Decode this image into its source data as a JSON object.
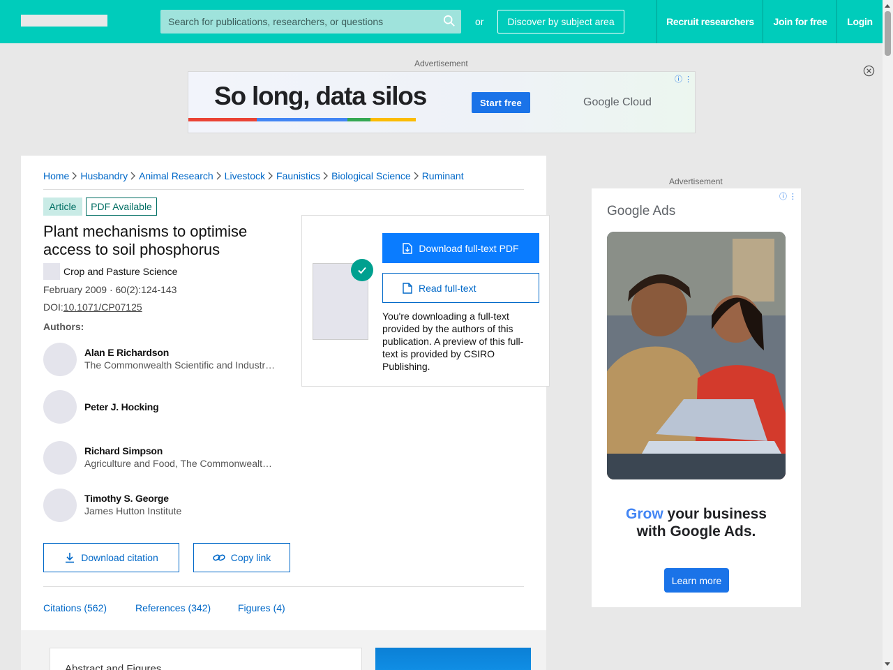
{
  "header": {
    "search_placeholder": "Search for publications, researchers, or questions",
    "or_text": "or",
    "discover_label": "Discover by subject area",
    "recruit_label": "Recruit researchers",
    "join_label": "Join for free",
    "login_label": "Login"
  },
  "ads": {
    "label": "Advertisement",
    "banner": {
      "headline": "So long, data silos",
      "cta": "Start free",
      "brand": "Google Cloud"
    },
    "side": {
      "brand": "Google Ads",
      "tagline_accent": "Grow",
      "tagline_line1_rest": " your business",
      "tagline_line2": "with Google Ads.",
      "cta": "Learn more"
    }
  },
  "breadcrumb": [
    "Home",
    "Husbandry",
    "Animal Research",
    "Livestock",
    "Faunistics",
    "Biological Science",
    "Ruminant"
  ],
  "publication": {
    "type_badge": "Article",
    "pdf_badge": "PDF Available",
    "title": "Plant mechanisms to optimise access to soil phosphorus",
    "journal": "Crop and Pasture Science",
    "date_pages": "February 2009 · 60(2):124-143",
    "doi_label": "DOI:",
    "doi": "10.1071/CP07125",
    "authors_label": "Authors:",
    "authors": [
      {
        "name": "Alan E Richardson",
        "affiliation": "The Commonwealth Scientific and Industrial Research Organisation"
      },
      {
        "name": "Peter J. Hocking",
        "affiliation": ""
      },
      {
        "name": "Richard Simpson",
        "affiliation": "Agriculture and Food, The Commonwealth Scientific and Industrial Research Organisation"
      },
      {
        "name": "Timothy S. George",
        "affiliation": "James Hutton Institute"
      }
    ],
    "download_citation": "Download citation",
    "copy_link": "Copy link"
  },
  "tabs": [
    "Citations (562)",
    "References (342)",
    "Figures (4)"
  ],
  "abstract_heading": "Abstract and Figures",
  "download_panel": {
    "primary": "Download full-text PDF",
    "secondary": "Read full-text",
    "note": "You're downloading a full-text provided by the authors of this publication. A preview of this full-text is provided by CSIRO Publishing."
  },
  "colors": {
    "brand": "#00ccbb",
    "link": "#0068c8",
    "primary_button": "#0a7cff"
  }
}
